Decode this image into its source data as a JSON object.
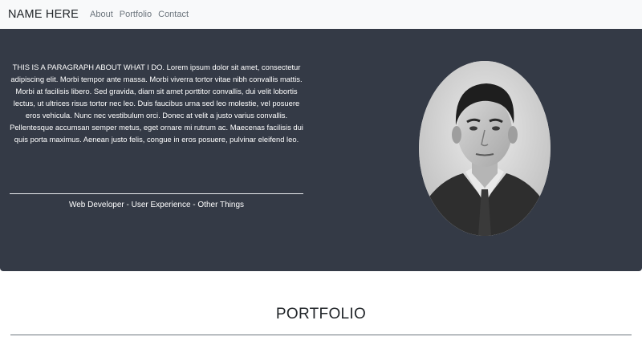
{
  "navbar": {
    "brand": "NAME HERE",
    "links": [
      "About",
      "Portfolio",
      "Contact"
    ]
  },
  "hero": {
    "paragraph": "THIS IS A PARAGRAPH ABOUT WHAT I DO. Lorem ipsum dolor sit amet, consectetur adipiscing elit. Morbi tempor ante massa. Morbi viverra tortor vitae nibh convallis mattis. Morbi at facilisis libero. Sed gravida, diam sit amet porttitor convallis, dui velit lobortis lectus, ut ultrices risus tortor nec leo. Duis faucibus urna sed leo molestie, vel posuere eros vehicula. Nunc nec vestibulum orci. Donec at velit a justo varius convallis. Pellentesque accumsan semper metus, eget ornare mi rutrum ac. Maecenas facilisis dui quis porta maximus. Aenean justo felis, congue in eros posuere, pulvinar eleifend leo.",
    "roles": "Web Developer - User Experience - Other Things"
  },
  "portfolio": {
    "title": "PORTFOLIO"
  },
  "colors": {
    "navbar_bg": "#f8f9fa",
    "hero_bg": "#343a46",
    "nav_link": "#6c757d"
  }
}
